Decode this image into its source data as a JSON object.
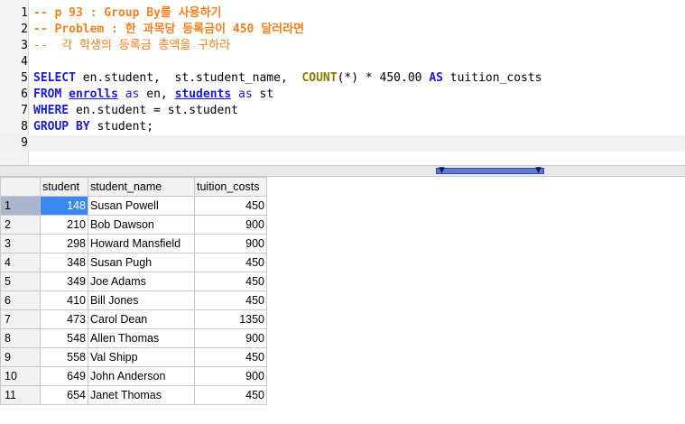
{
  "editor": {
    "lines": [
      {
        "n": "1",
        "parts": [
          {
            "t": "-- p 93 : Group By를 사용하기",
            "c": "cmt-b"
          }
        ]
      },
      {
        "n": "2",
        "parts": [
          {
            "t": "-- Problem : 한 과목당 등록금이 450 달러라면",
            "c": "cmt-b"
          }
        ]
      },
      {
        "n": "3",
        "parts": [
          {
            "t": "--  각 학생의 등록금 총액을 구하라",
            "c": "cmt"
          }
        ]
      },
      {
        "n": "4",
        "parts": []
      },
      {
        "n": "5",
        "parts": [
          {
            "t": "SELECT",
            "c": "kw"
          },
          {
            "t": " en.student,  st.student_name,  ",
            "c": ""
          },
          {
            "t": "COUNT",
            "c": "fn"
          },
          {
            "t": "(*) * 450.00 ",
            "c": ""
          },
          {
            "t": "AS",
            "c": "kw"
          },
          {
            "t": " tuition_costs",
            "c": ""
          }
        ]
      },
      {
        "n": "6",
        "parts": [
          {
            "t": "FROM",
            "c": "kw"
          },
          {
            "t": " ",
            "c": ""
          },
          {
            "t": "enrolls",
            "c": "tbl"
          },
          {
            "t": " ",
            "c": ""
          },
          {
            "t": "as",
            "c": "rsv"
          },
          {
            "t": " en, ",
            "c": ""
          },
          {
            "t": "students",
            "c": "tbl"
          },
          {
            "t": " ",
            "c": ""
          },
          {
            "t": "as",
            "c": "rsv"
          },
          {
            "t": " st",
            "c": ""
          }
        ]
      },
      {
        "n": "7",
        "parts": [
          {
            "t": "WHERE",
            "c": "kw"
          },
          {
            "t": " en.student = st.student",
            "c": ""
          }
        ]
      },
      {
        "n": "8",
        "parts": [
          {
            "t": "GROUP BY",
            "c": "kw"
          },
          {
            "t": " student;",
            "c": ""
          }
        ]
      },
      {
        "n": "9",
        "parts": []
      }
    ]
  },
  "results": {
    "columns": [
      "student",
      "student_name",
      "tuition_costs"
    ],
    "rows": [
      [
        "1",
        "148",
        "Susan Powell",
        "450"
      ],
      [
        "2",
        "210",
        "Bob Dawson",
        "900"
      ],
      [
        "3",
        "298",
        "Howard Mansfield",
        "900"
      ],
      [
        "4",
        "348",
        "Susan Pugh",
        "450"
      ],
      [
        "5",
        "349",
        "Joe Adams",
        "450"
      ],
      [
        "6",
        "410",
        "Bill Jones",
        "450"
      ],
      [
        "7",
        "473",
        "Carol Dean",
        "1350"
      ],
      [
        "8",
        "548",
        "Allen Thomas",
        "900"
      ],
      [
        "9",
        "558",
        "Val Shipp",
        "450"
      ],
      [
        "10",
        "649",
        "John Anderson",
        "900"
      ],
      [
        "11",
        "654",
        "Janet Thomas",
        "450"
      ]
    ]
  },
  "splitter": {
    "left_arrow": "▼",
    "right_arrow": "▼"
  },
  "colors": {
    "active_cell": "#3a88f0",
    "keyword": "#1a1ad4",
    "comment": "#f08020",
    "function": "#8a7a00"
  }
}
